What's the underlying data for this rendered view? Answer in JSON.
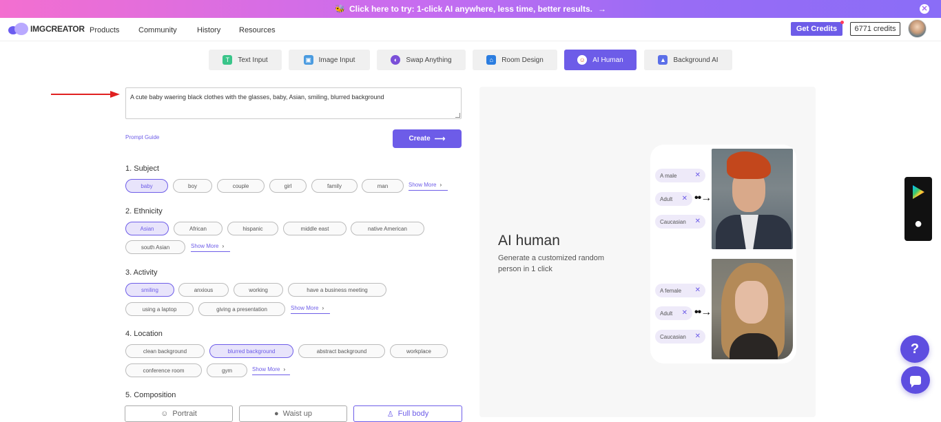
{
  "banner": {
    "text": "Click here to try: 1-click AI anywhere, less time, better results.",
    "emoji": "🐝",
    "arrow": "→",
    "close": "✕"
  },
  "nav": {
    "logo_text": "IMGCREATOR",
    "items": [
      "Products",
      "Community",
      "History",
      "Resources"
    ],
    "get_credits": "Get Credits",
    "credits_count": "6771 credits"
  },
  "tabs": [
    {
      "label": "Text Input",
      "icon": "text-icon",
      "color": "#3ac58a"
    },
    {
      "label": "Image Input",
      "icon": "image-icon",
      "color": "#4a9be0"
    },
    {
      "label": "Swap Anything",
      "icon": "swap-icon",
      "color": "#7a4fd8"
    },
    {
      "label": "Room Design",
      "icon": "house-icon",
      "color": "#2b7de0"
    },
    {
      "label": "AI Human",
      "icon": "human-icon",
      "color": "#ffffff"
    },
    {
      "label": "Background AI",
      "icon": "mountain-icon",
      "color": "#5b6fe8"
    }
  ],
  "prompt": {
    "value": "A cute baby waering black clothes with the glasses, baby, Asian, smiling, blurred background",
    "guide_label": "Prompt Guide",
    "create_label": "Create",
    "create_arrow": "⟶"
  },
  "sections": {
    "subject": {
      "title": "1. Subject",
      "chips": [
        "baby",
        "boy",
        "couple",
        "girl",
        "family",
        "man"
      ],
      "selected": "baby",
      "show_more": "Show More"
    },
    "ethnicity": {
      "title": "2. Ethnicity",
      "chips": [
        "Asian",
        "African",
        "hispanic",
        "middle east",
        "native American",
        "south Asian"
      ],
      "selected": "Asian",
      "show_more": "Show More"
    },
    "activity": {
      "title": "3. Activity",
      "chips": [
        "smiling",
        "anxious",
        "working",
        "have a business meeting",
        "using a laptop",
        "giving a presentation"
      ],
      "selected": "smiling",
      "show_more": "Show More"
    },
    "location": {
      "title": "4. Location",
      "chips": [
        "clean background",
        "blurred background",
        "abstract background",
        "workplace",
        "conference room",
        "gym"
      ],
      "selected": "blurred background",
      "show_more": "Show More"
    },
    "composition": {
      "title": "5. Composition",
      "options": [
        "Portrait",
        "Waist up",
        "Full body"
      ],
      "selected": "Full body"
    }
  },
  "preview": {
    "title": "AI human",
    "subtitle": "Generate a customized random person in 1 click",
    "male_tags": [
      "A male",
      "Adult",
      "Caucasian"
    ],
    "female_tags": [
      "A female",
      "Adult",
      "Caucasian"
    ],
    "tag_close": "✕",
    "arrow": "••→"
  },
  "help": {
    "question": "?"
  },
  "colors": {
    "accent": "#6d5ce8",
    "banner_start": "#f36fd0",
    "banner_end": "#8a6df7"
  }
}
